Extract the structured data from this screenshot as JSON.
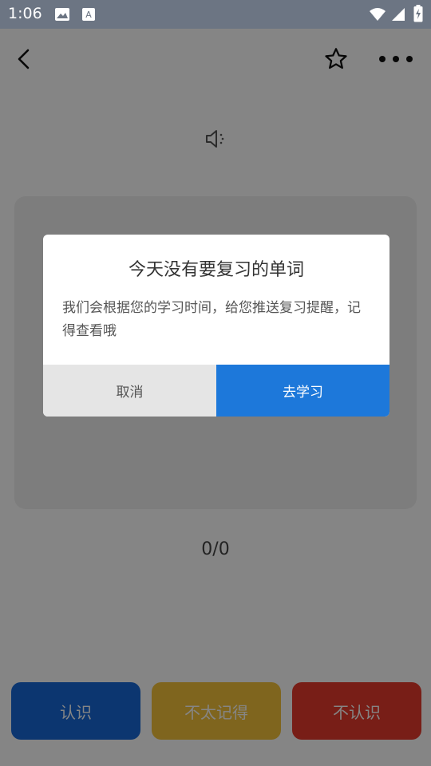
{
  "status_bar": {
    "time": "1:06",
    "icons": [
      "image-icon",
      "keyboard-a-icon",
      "wifi-icon",
      "signal-icon",
      "battery-charging-icon"
    ]
  },
  "app_bar": {
    "back_icon": "back-arrow-icon",
    "favorite_icon": "star-outline-icon",
    "more_icon": "more-dots-icon"
  },
  "word_card": {
    "speaker_icon": "speaker-icon"
  },
  "progress": {
    "text": "0/0"
  },
  "actions": {
    "know": "认识",
    "unsure": "不太记得",
    "unknown": "不认识"
  },
  "dialog": {
    "title": "今天没有要复习的单词",
    "message": "我们会根据您的学习时间，给您推送复习提醒，记得查看哦",
    "cancel_label": "取消",
    "confirm_label": "去学习"
  },
  "colors": {
    "status_bar": "#6c7583",
    "know": "#1869d6",
    "unsure": "#f3c23a",
    "unknown": "#e73b2c",
    "confirm": "#1d78da",
    "cancel": "#e5e5e5",
    "overlay": "rgba(0,0,0,0.48)"
  }
}
